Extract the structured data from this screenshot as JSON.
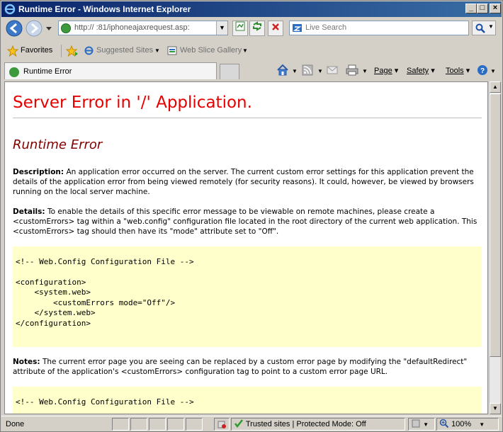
{
  "window": {
    "title": "Runtime Error - Windows Internet Explorer",
    "minimize": "_",
    "maximize": "□",
    "close": "×"
  },
  "address_bar": {
    "url": "http://           :81/iphoneajaxrequest.asp:",
    "search_placeholder": "Live Search"
  },
  "favorites_bar": {
    "favorites_label": "Favorites",
    "suggested_sites": "Suggested Sites",
    "web_slice_gallery": "Web Slice Gallery"
  },
  "tab": {
    "label": "Runtime Error"
  },
  "command_bar": {
    "page": "Page",
    "safety": "Safety",
    "tools": "Tools"
  },
  "page": {
    "heading": "Server Error in '/' Application.",
    "subheading": "Runtime Error",
    "description_label": "Description:",
    "description_text": "An application error occurred on the server. The current custom error settings for this application prevent the details of the application error from being viewed remotely (for security reasons). It could, however, be viewed by browsers running on the local server machine.",
    "details_label": "Details:",
    "details_text": "To enable the details of this specific error message to be viewable on remote machines, please create a <customErrors> tag within a \"web.config\" configuration file located in the root directory of the current web application. This <customErrors> tag should then have its \"mode\" attribute set to \"Off\".",
    "code1": "\n<!-- Web.Config Configuration File -->\n\n<configuration>\n    <system.web>\n        <customErrors mode=\"Off\"/>\n    </system.web>\n</configuration>\n",
    "notes_label": "Notes:",
    "notes_text": "The current error page you are seeing can be replaced by a custom error page by modifying the \"defaultRedirect\" attribute of the application's <customErrors> configuration tag to point to a custom error page URL.",
    "code2": "\n<!-- Web.Config Configuration File -->"
  },
  "status_bar": {
    "status": "Done",
    "zone": "Trusted sites | Protected Mode: Off",
    "zoom": "100%"
  },
  "colors": {
    "heading_red": "#e80000",
    "subheading_maroon": "#800000",
    "code_bg": "#ffffcc",
    "titlebar_start": "#0a246a",
    "titlebar_end": "#3a6ea5"
  }
}
